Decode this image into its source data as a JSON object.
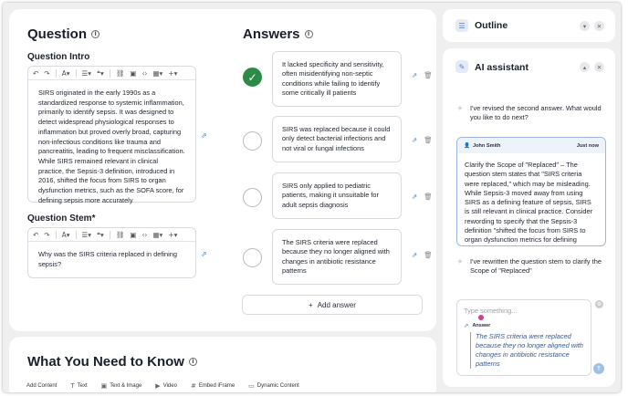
{
  "question": {
    "title": "Question",
    "intro_label": "Question Intro",
    "intro_text": "SIRS originated in the early 1990s as a standardized response to systemic inflammation, primarily to identify sepsis. It was designed to detect widespread physiological responses to inflammation but proved overly broad, capturing non-infectious conditions like trauma and pancreatitis, leading to frequent misclassification. While SIRS remained relevant in clinical practice, the Sepsis-3 definition, introduced in 2016, shifted the focus from SIRS to organ dysfunction metrics, such as the SOFA score, for defining sepsis more accurately",
    "stem_label": "Question Stem*",
    "stem_text": "Why was the SIRS criteria replaced in defining sepsis?",
    "toolbar": {
      "undo": "↶",
      "redo": "↷",
      "text_style": "A",
      "link": "🔗",
      "insert": "+"
    }
  },
  "answers": {
    "title": "Answers",
    "items": [
      {
        "text": "It lacked specificity and sensitivity, often misidentifying non-septic conditions while failing to identify some critically ill patients",
        "correct": true
      },
      {
        "text": "SIRS was replaced because it could only detect bacterial infections and not viral or fungal infections",
        "correct": false
      },
      {
        "text": "SIRS only applied to pediatric patients, making it unsuitable for adult sepsis diagnosis",
        "correct": false
      },
      {
        "text": "The SIRS criteria were replaced because they no longer aligned with changes in antibiotic resistance patterns",
        "correct": false
      }
    ],
    "add_label": "Add answer"
  },
  "need_to_know": {
    "title": "What You Need to Know",
    "toolbar": [
      "Add Content",
      "Text",
      "Text & Image",
      "Video",
      "Embed iFrame",
      "Dynamic Content"
    ]
  },
  "outline": {
    "title": "Outline"
  },
  "ai_assistant": {
    "title": "AI assistant",
    "msg_1": "I've revised the second answer. What would you like to do next?",
    "user_name": "John Smith",
    "user_time": "Just now",
    "user_msg": "Clarify the Scope of \"Replaced\" – The question stem states that \"SIRS criteria were replaced,\" which may be misleading. While Sepsis-3 moved away from using SIRS as a defining feature of sepsis, SIRS is still relevant in clinical practice. Consider rewording to specify that the Sepsis-3 definition \"shifted the focus from SIRS to organ dysfunction metrics for defining sepsis.\"",
    "msg_2": "I've rewritten the question stem to clarify the Scope of \"Replaced\"",
    "composer_placeholder": "Type something...",
    "quote_label": "Answer",
    "quote_text": "The SIRS criteria were replaced because they no longer aligned with changes in antibiotic resistance patterns"
  }
}
